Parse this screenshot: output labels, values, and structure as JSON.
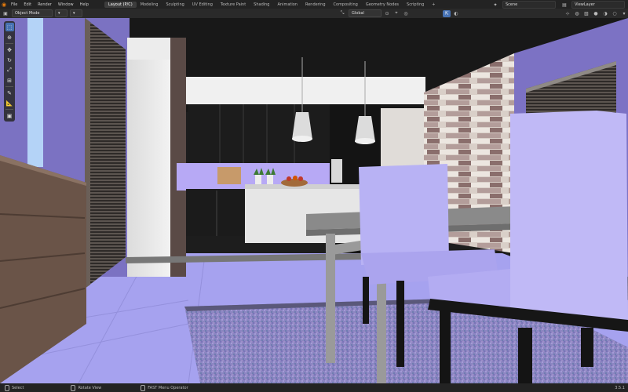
{
  "app": {
    "menu": [
      "File",
      "Edit",
      "Render",
      "Window",
      "Help"
    ],
    "workspaces": [
      "Layout (P/C)",
      "Modeling",
      "Sculpting",
      "UV Editing",
      "Texture Paint",
      "Shading",
      "Animation",
      "Rendering",
      "Compositing",
      "Geometry Nodes",
      "Scripting"
    ],
    "active_workspace": 0,
    "scene_label": "Scene",
    "view_layer_label": "ViewLayer"
  },
  "header": {
    "mode": "Object Mode",
    "orientation": "Global"
  },
  "status": {
    "left": "Select",
    "middle": "Rotate View",
    "right": "FAST Menu Operator",
    "version": "3.5.1"
  },
  "colors": {
    "accent": "#4772b3",
    "brand": "#e87d0d",
    "wall": "#7d73c4",
    "floor": "#a8a4f0",
    "chair": "#b4aef5"
  }
}
